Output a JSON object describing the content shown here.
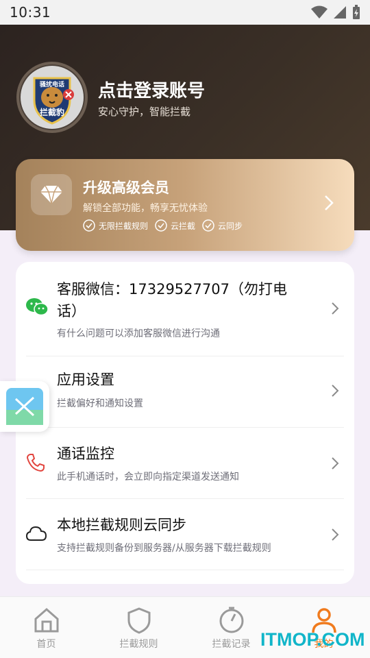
{
  "status_bar": {
    "time": "10:31"
  },
  "profile": {
    "avatar_badge_top": "骚扰电话",
    "avatar_badge_bottom": "拦截豹",
    "login_title": "点击登录账号",
    "login_subtitle": "安心守护，智能拦截"
  },
  "vip": {
    "title": "升级高级会员",
    "subtitle": "解锁全部功能，畅享无忧体验",
    "features": [
      "无限拦截规则",
      "云拦截",
      "云同步"
    ]
  },
  "menu": [
    {
      "title": "客服微信：17329527707（勿打电",
      "title_line2": "话）",
      "desc": "有什么问题可以添加客服微信进行沟通",
      "icon": "wechat-icon"
    },
    {
      "title": "应用设置",
      "desc": "拦截偏好和通知设置",
      "icon": "settings-gear-icon"
    },
    {
      "title": "通话监控",
      "desc": "此手机通话时，会立即向指定渠道发送通知",
      "icon": "phone-icon"
    },
    {
      "title": "本地拦截规则云同步",
      "desc": "支持拦截规则备份到服务器/从服务器下载拦截规则",
      "icon": "cloud-icon"
    }
  ],
  "tabs": [
    {
      "label": "首页",
      "icon": "home-icon"
    },
    {
      "label": "拦截规则",
      "icon": "shield-icon"
    },
    {
      "label": "拦截记录",
      "icon": "timer-icon"
    },
    {
      "label": "我的",
      "icon": "user-icon",
      "active": true
    }
  ],
  "watermark": "ITMOP.COM",
  "colors": {
    "accent": "#f07b1e",
    "hero_bg": "#2c2320",
    "vip_gold": "#c7a27a",
    "watermark": "#11b5c9"
  }
}
